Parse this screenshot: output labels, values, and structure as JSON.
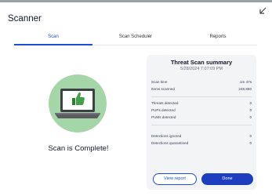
{
  "app": {
    "title": "Scanner"
  },
  "tabs": [
    {
      "label": "Scan",
      "active": true
    },
    {
      "label": "Scan Scheduler",
      "active": false
    },
    {
      "label": "Reports",
      "active": false
    }
  ],
  "status": {
    "message": "Scan is Complete!"
  },
  "summary": {
    "title": "Threat Scan summary",
    "date": "5/28/2024 7:07:09 PM",
    "groups": [
      {
        "rows": [
          {
            "label": "Scan time",
            "value": "1m 47s"
          },
          {
            "label": "Items scanned",
            "value": "248,860"
          }
        ]
      },
      {
        "rows": [
          {
            "label": "Threats detected",
            "value": "0"
          },
          {
            "label": "PUPs detected",
            "value": "0"
          },
          {
            "label": "PUMs detected",
            "value": "0"
          }
        ]
      },
      {
        "rows": [
          {
            "label": "Detections ignored",
            "value": "0"
          },
          {
            "label": "Detections quarantined",
            "value": "0"
          }
        ]
      }
    ],
    "buttons": {
      "view_report": "View report",
      "done": "Done"
    }
  },
  "colors": {
    "accent": "#1d4ed8",
    "illustration": "#a5d6a7",
    "card": "#f3f4f6"
  },
  "icons": {
    "collapse": "collapse-arrow-icon",
    "thumbs_up": "thumbs-up-icon"
  }
}
